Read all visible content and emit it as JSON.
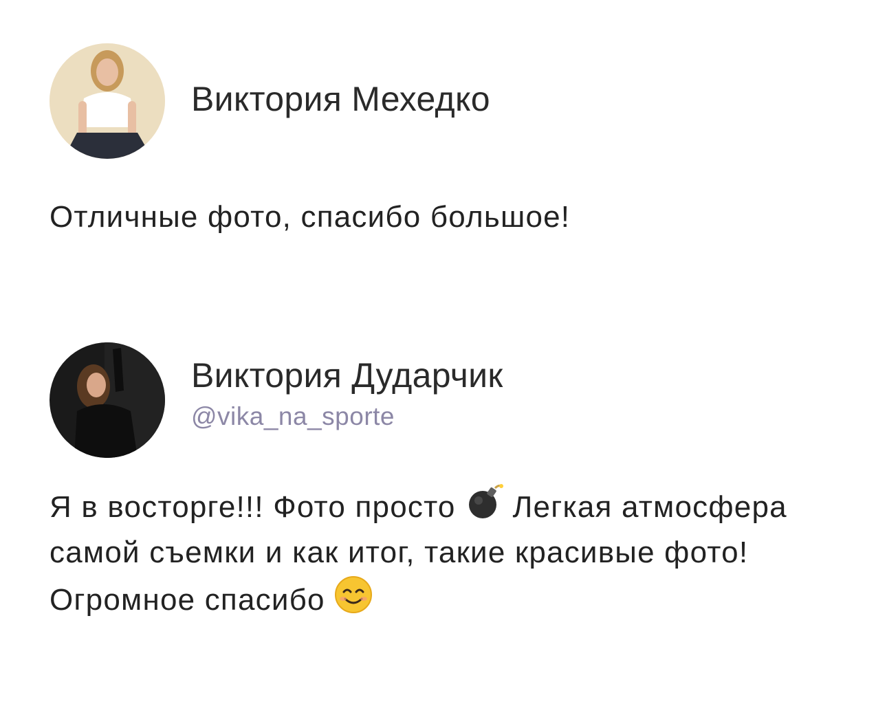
{
  "reviews": [
    {
      "author": "Виктория Мехедко",
      "text": "Отличные фото, спасибо большое!",
      "avatar": {
        "bg": "#e9d6b5",
        "shirt": "#ffffff",
        "pants": "#2b2f3a",
        "hair": "#c79a5b",
        "skin": "#e8bfa3"
      }
    },
    {
      "author": "Виктория Дударчик",
      "handle": "@vika_na_sporte",
      "text_part1": "Я в восторге!!! Фото просто ",
      "text_part2": " Легкая атмосфера самой съемки и как итог, такие красивые фото! Огромное спасибо ",
      "emoji_1": "bomb-emoji",
      "emoji_2": "smiling-face-emoji",
      "avatar": {
        "bg": "#1a1a1a",
        "outfit": "#0e0e0e",
        "hair": "#5a3a22",
        "skin": "#d9a78a"
      }
    }
  ]
}
